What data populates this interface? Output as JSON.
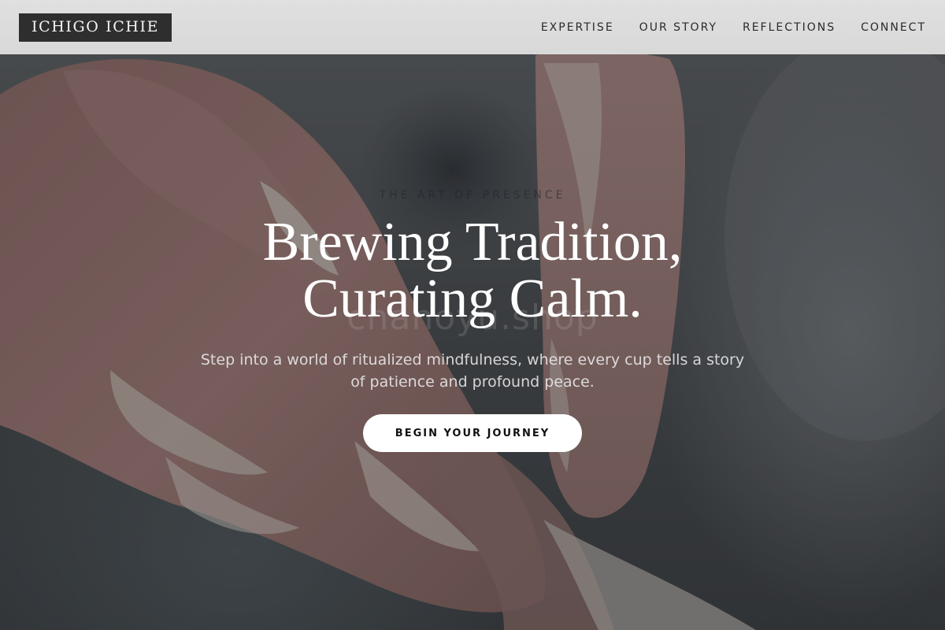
{
  "brand": {
    "logo_text": "ICHIGO ICHIE"
  },
  "nav": {
    "items": [
      {
        "label": "EXPERTISE"
      },
      {
        "label": "OUR STORY"
      },
      {
        "label": "REFLECTIONS"
      },
      {
        "label": "CONNECT"
      }
    ]
  },
  "hero": {
    "eyebrow": "THE ART OF PRESENCE",
    "watermark": "chanoyu.shop",
    "headline_line1": "Brewing Tradition,",
    "headline_line2": "Curating Calm.",
    "subtitle": "Step into a world of ritualized mindfulness, where every cup tells a story of patience and profound peace.",
    "cta_label": "BEGIN YOUR JOURNEY",
    "background_image": "hands-shaping-clay-photo"
  },
  "colors": {
    "nav_background": "#e2e2e2",
    "logo_background": "#2e2e2e",
    "logo_text": "#f4f4f4",
    "headline": "#ffffff",
    "cta_background": "#ffffff",
    "cta_text": "#111111"
  }
}
